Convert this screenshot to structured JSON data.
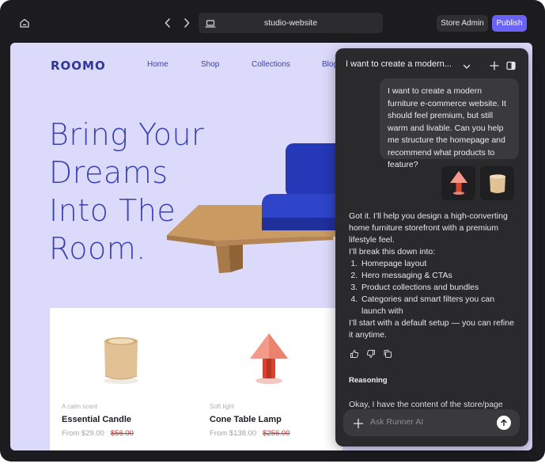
{
  "toolbar": {
    "address": "studio-website",
    "store_admin": "Store Admin",
    "publish": "Publish"
  },
  "site": {
    "logo": "ROOMO",
    "nav": [
      "Home",
      "Shop",
      "Collections",
      "Blog"
    ],
    "hero": [
      "Bring Your",
      "Dreams",
      "Into The",
      "Room."
    ],
    "products": [
      {
        "kicker": "A calm scent",
        "name": "Essential Candle",
        "price": "From $29.00",
        "old_price": "$56.00"
      },
      {
        "kicker": "Soft light",
        "name": "Cone Table Lamp",
        "price": "From $138.00",
        "old_price": "$256.00"
      }
    ]
  },
  "chat": {
    "title": "I want to create a modern...",
    "user_message": "I want to create a modern furniture e-commerce website. It should feel premium, but still warm and livable. Can you help me structure the homepage and recommend what products to feature?",
    "reply_intro": "Got it. I’ll help you design a high-converting home furniture storefront with a premium lifestyle feel.",
    "reply_break": "I’ll break this down into:",
    "reply_items": [
      "Homepage layout",
      "Hero messaging & CTAs",
      "Product collections and bundles",
      "Categories and smart filters you can launch with"
    ],
    "reply_outro": "I’ll start with a default setup — you can refine it anytime.",
    "reasoning_label": "Reasoning",
    "reasoning_text": "Okay, I have the content of the store/page",
    "composer_placeholder": "Ask Runner AI"
  },
  "colors": {
    "accent": "#6b63f5",
    "site_bg": "#dcdafb",
    "brand_text": "#3a42b0",
    "sofa_blue": "#2438b8"
  },
  "icons": [
    "home-icon",
    "chevron-left-icon",
    "chevron-right-icon",
    "laptop-icon",
    "chevron-down-icon",
    "plus-icon",
    "panel-icon",
    "thumbs-up-icon",
    "thumbs-down-icon",
    "copy-icon",
    "send-icon"
  ]
}
